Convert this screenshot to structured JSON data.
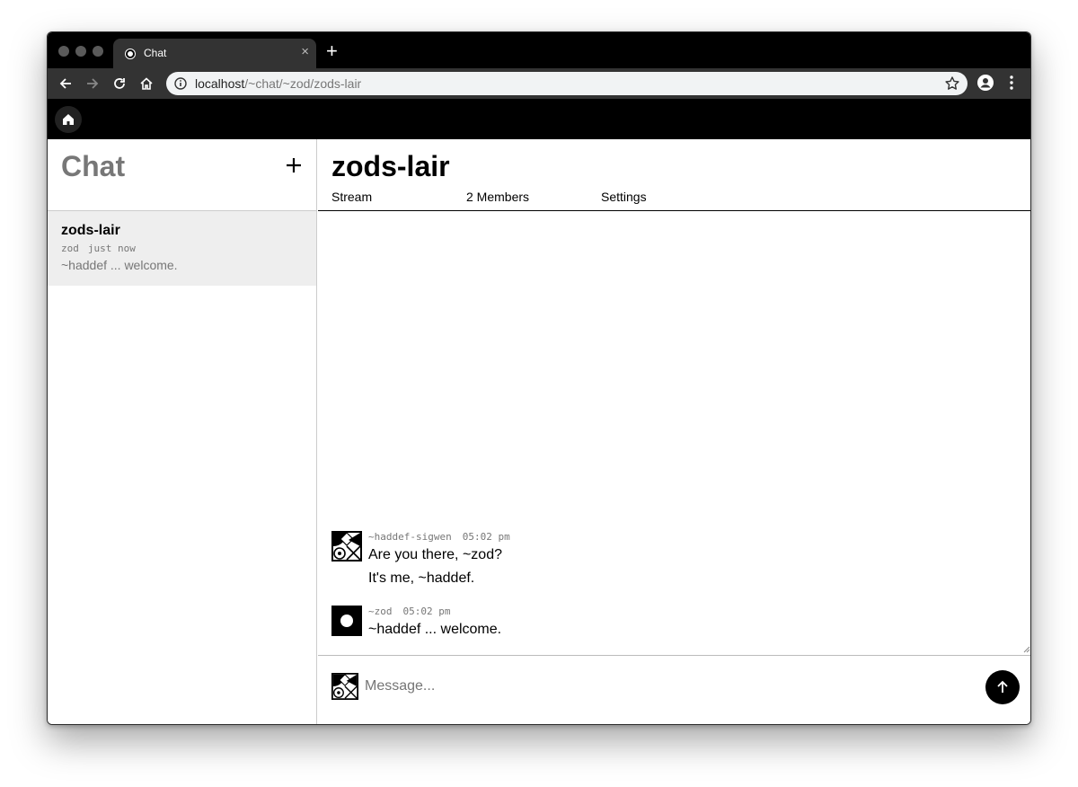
{
  "browser": {
    "tab_title": "Chat",
    "tab_close": "×",
    "new_tab": "+",
    "url_host": "localhost",
    "url_path": "/~chat/~zod/zods-lair"
  },
  "sidebar": {
    "title": "Chat",
    "add_label": "+",
    "chats": [
      {
        "name": "zods-lair",
        "author": "zod",
        "time": "just now",
        "preview": "~haddef ... welcome."
      }
    ]
  },
  "channel": {
    "title": "zods-lair",
    "tabs": [
      {
        "label": "Stream",
        "active": true
      },
      {
        "label": "2 Members",
        "active": false
      },
      {
        "label": "Settings",
        "active": false
      }
    ]
  },
  "messages": [
    {
      "author": "~haddef-sigwen",
      "time": "05:02 pm",
      "lines": [
        "Are you there, ~zod?",
        "It's me, ~haddef."
      ]
    },
    {
      "author": "~zod",
      "time": "05:02 pm",
      "lines": [
        "~haddef ... welcome."
      ]
    }
  ],
  "composer": {
    "placeholder": "Message..."
  },
  "colors": {
    "accent": "#000000",
    "muted": "#777777",
    "selected_bg": "#eeeeee"
  },
  "icons": [
    "back-icon",
    "forward-icon",
    "reload-icon",
    "home-icon",
    "info-icon",
    "star-icon",
    "account-icon",
    "menu-icon",
    "plus-icon",
    "send-arrow-icon",
    "sigil-icon"
  ]
}
